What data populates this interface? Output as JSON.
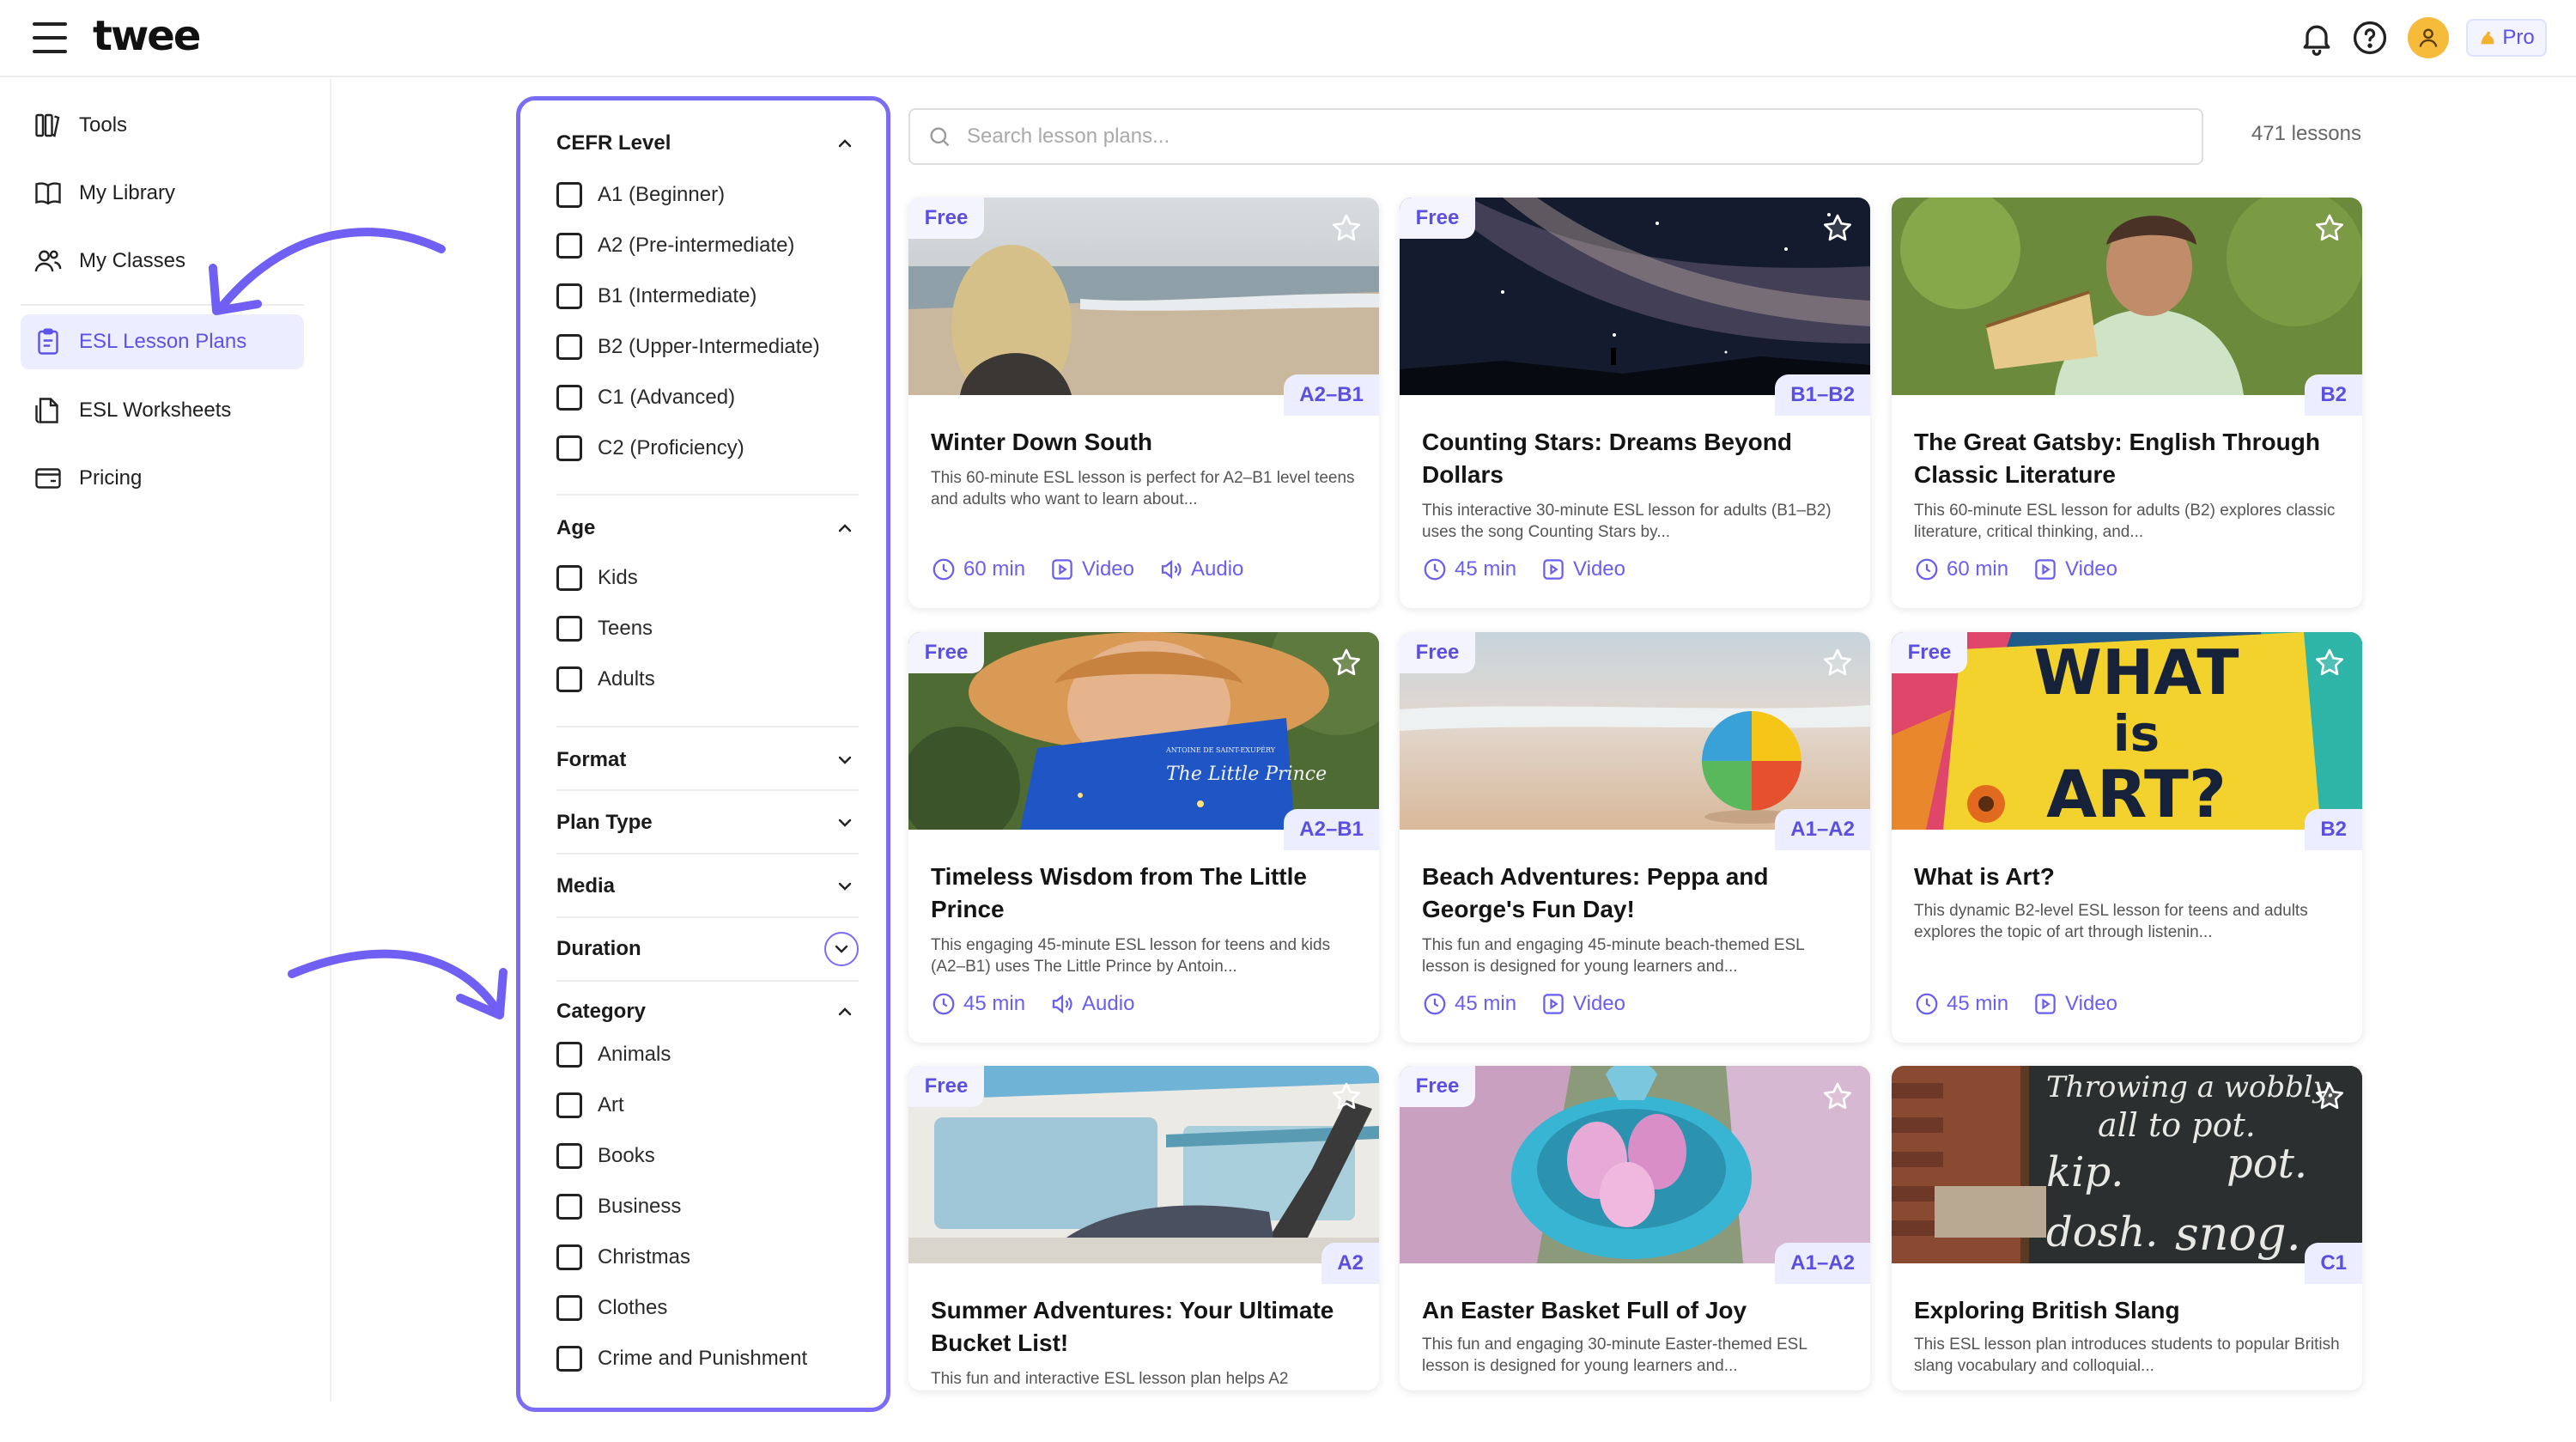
{
  "app": {
    "logo": "twee",
    "pro_label": "Pro"
  },
  "sidebar": {
    "items": [
      {
        "label": "Tools",
        "icon": "tools-icon"
      },
      {
        "label": "My Library",
        "icon": "book-icon"
      },
      {
        "label": "My Classes",
        "icon": "users-icon"
      },
      {
        "label": "ESL Lesson Plans",
        "icon": "clipboard-icon",
        "active": true
      },
      {
        "label": "ESL Worksheets",
        "icon": "worksheet-icon"
      },
      {
        "label": "Pricing",
        "icon": "wallet-icon"
      }
    ]
  },
  "filters": {
    "cefr": {
      "title": "CEFR Level",
      "options": [
        "A1 (Beginner)",
        "A2 (Pre-intermediate)",
        "B1 (Intermediate)",
        "B2 (Upper-Intermediate)",
        "C1 (Advanced)",
        "C2 (Proficiency)"
      ]
    },
    "age": {
      "title": "Age",
      "options": [
        "Kids",
        "Teens",
        "Adults"
      ]
    },
    "format": {
      "title": "Format"
    },
    "plan_type": {
      "title": "Plan Type"
    },
    "media": {
      "title": "Media"
    },
    "duration": {
      "title": "Duration"
    },
    "category": {
      "title": "Category",
      "options": [
        "Animals",
        "Art",
        "Books",
        "Business",
        "Christmas",
        "Clothes",
        "Crime and Punishment"
      ]
    }
  },
  "search": {
    "placeholder": "Search lesson plans...",
    "count": "471 lessons"
  },
  "colors": {
    "accent": "#6a5ef0",
    "highlight": "#7b6cf5",
    "badge_bg": "#eceeff"
  },
  "cards": [
    {
      "free": "Free",
      "level": "A2–B1",
      "title": "Winter Down South",
      "desc": "This 60-minute ESL lesson is perfect for A2–B1 level teens and adults who want to learn about...",
      "time": "60 min",
      "m1": "Video",
      "m2": "Audio"
    },
    {
      "free": "Free",
      "level": "B1–B2",
      "title": "Counting Stars: Dreams Beyond Dollars",
      "desc": "This interactive 30-minute ESL lesson for adults (B1–B2) uses the song Counting Stars by...",
      "time": "45 min",
      "m1": "Video",
      "m2": ""
    },
    {
      "free": "",
      "level": "B2",
      "title": "The Great Gatsby: English Through Classic Literature",
      "desc": "This 60-minute ESL lesson for adults (B2) explores classic literature, critical thinking, and...",
      "time": "60 min",
      "m1": "Video",
      "m2": ""
    },
    {
      "free": "Free",
      "level": "A2–B1",
      "title": "Timeless Wisdom from The Little Prince",
      "desc": "This engaging 45-minute ESL lesson for teens and kids (A2–B1) uses The Little Prince by Antoin...",
      "time": "45 min",
      "m1": "Audio",
      "m2": ""
    },
    {
      "free": "Free",
      "level": "A1–A2",
      "title": "Beach Adventures: Peppa and George's Fun Day!",
      "desc": "This fun and engaging 45-minute beach-themed ESL lesson is designed for young learners and...",
      "time": "45 min",
      "m1": "Video",
      "m2": ""
    },
    {
      "free": "Free",
      "level": "B2",
      "title": "What is Art?",
      "desc": "This dynamic B2-level ESL lesson for teens and adults explores the topic of art through listenin...",
      "time": "45 min",
      "m1": "Video",
      "m2": ""
    },
    {
      "free": "Free",
      "level": "A2",
      "title": "Summer Adventures: Your Ultimate Bucket List!",
      "desc": "This fun and interactive ESL lesson plan helps A2",
      "time": "",
      "m1": "",
      "m2": ""
    },
    {
      "free": "Free",
      "level": "A1–A2",
      "title": "An Easter Basket Full of Joy",
      "desc": "This fun and engaging 30-minute Easter-themed ESL lesson is designed for young learners and...",
      "time": "",
      "m1": "",
      "m2": ""
    },
    {
      "free": "",
      "level": "C1",
      "title": "Exploring British Slang",
      "desc": "This ESL lesson plan introduces students to popular British slang vocabulary and colloquial...",
      "time": "",
      "m1": "",
      "m2": ""
    }
  ],
  "image_text": {
    "book_title": "The Little Prince",
    "book_author": "ANTOINE DE SAINT-EXUPÉRY",
    "poster": [
      "WHAT",
      "is",
      "ART?"
    ],
    "chalk": [
      "Throwing a wobbly.",
      "all to pot.",
      "kip.",
      "pot.",
      "dosh.",
      "snog."
    ]
  }
}
